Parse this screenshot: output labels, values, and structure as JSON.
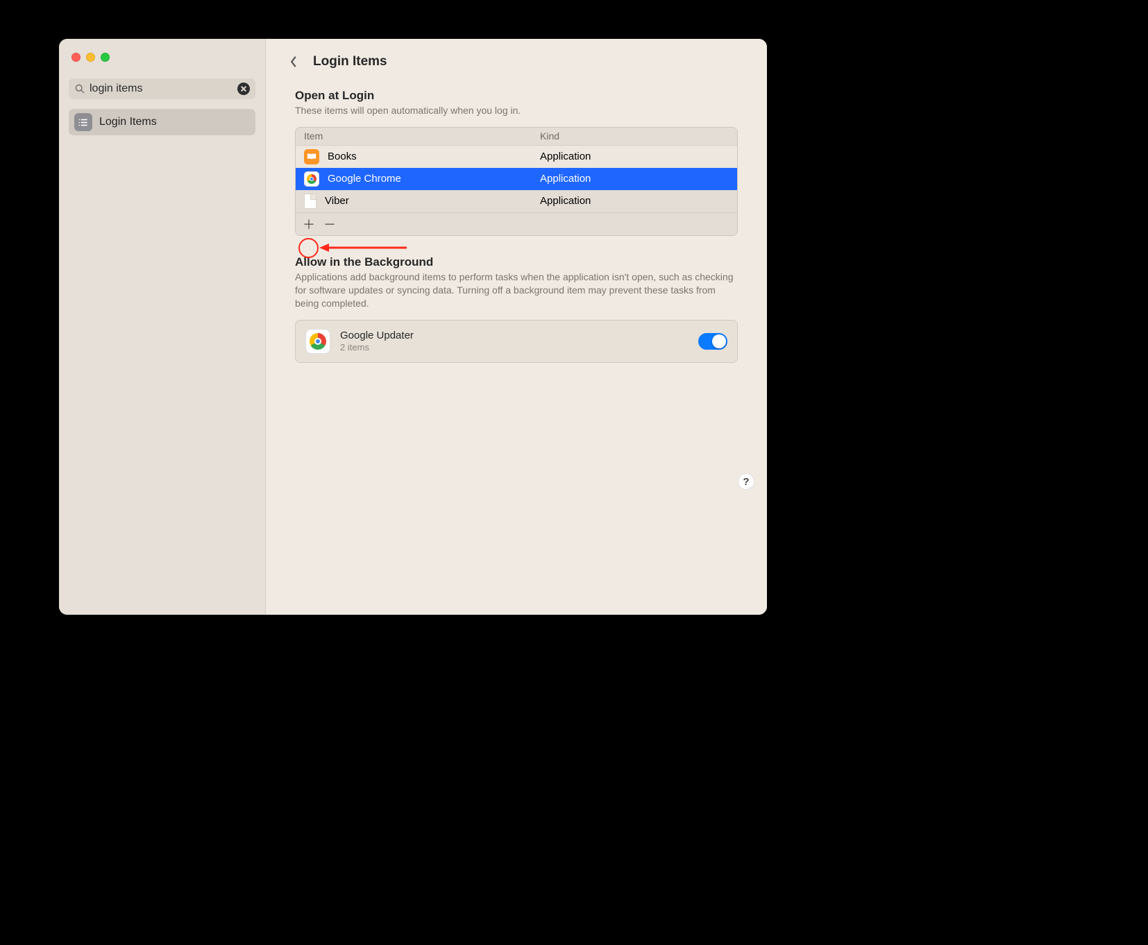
{
  "sidebar": {
    "search_value": "login items",
    "items": [
      {
        "label": "Login Items"
      }
    ]
  },
  "header": {
    "title": "Login Items"
  },
  "open_at_login": {
    "title": "Open at Login",
    "description": "These items will open automatically when you log in.",
    "columns": {
      "item": "Item",
      "kind": "Kind"
    },
    "rows": [
      {
        "name": "Books",
        "kind": "Application",
        "icon": "books",
        "selected": false
      },
      {
        "name": "Google Chrome",
        "kind": "Application",
        "icon": "chrome",
        "selected": true
      },
      {
        "name": "Viber",
        "kind": "Application",
        "icon": "doc",
        "selected": false
      }
    ]
  },
  "allow_in_background": {
    "title": "Allow in the Background",
    "description": "Applications add background items to perform tasks when the application isn't open, such as checking for software updates or syncing data. Turning off a background item may prevent these tasks from being completed.",
    "items": [
      {
        "name": "Google Updater",
        "sub": "2 items",
        "icon": "chrome",
        "enabled": true
      }
    ]
  },
  "help_label": "?"
}
